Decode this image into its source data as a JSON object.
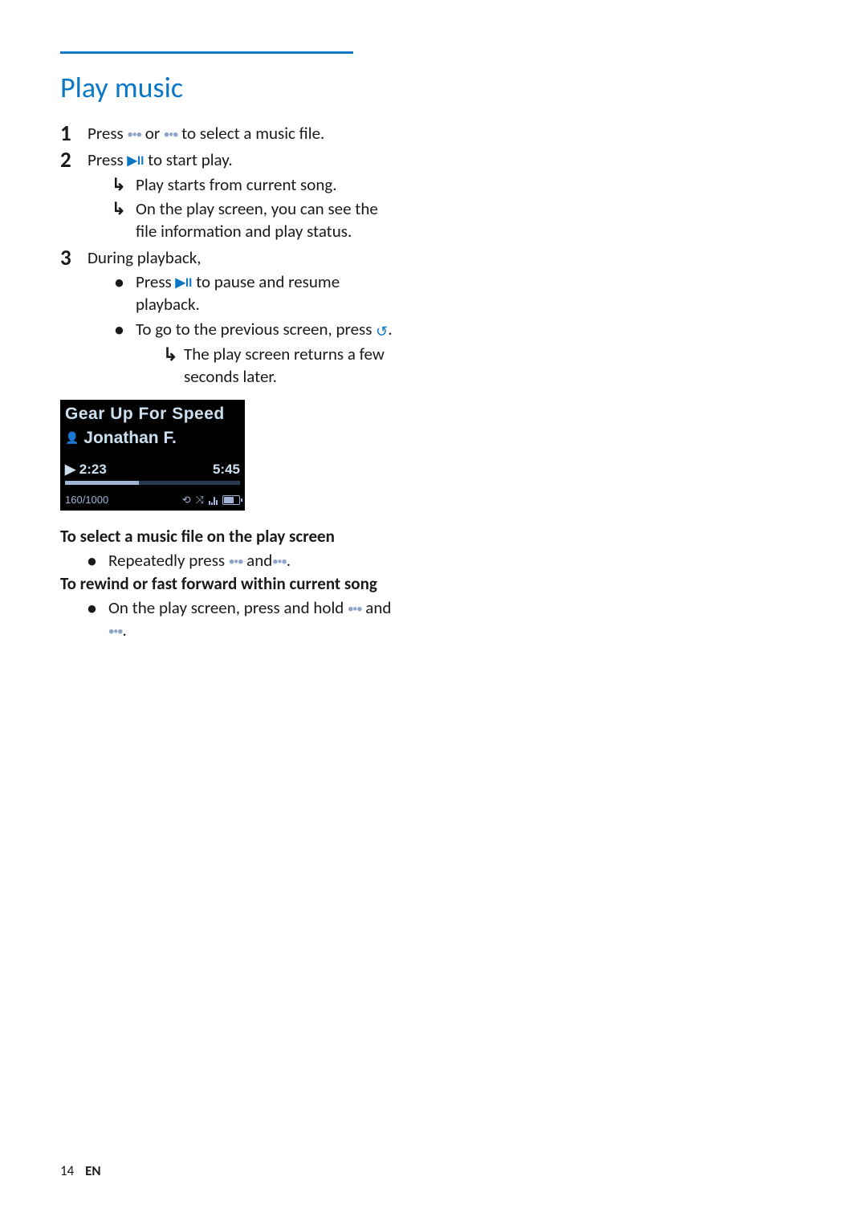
{
  "heading": "Play music",
  "step1": {
    "pre": "Press ",
    "mid": " or ",
    "post": " to select a music file."
  },
  "step2": {
    "pre": "Press ",
    "post": " to start play.",
    "sub1": "Play starts from current song.",
    "sub2": "On the play screen, you can see the file information and play status."
  },
  "step3": {
    "lead": "During playback,",
    "b1pre": "Press ",
    "b1post": " to pause and resume playback.",
    "b2pre": "To go to the previous screen, press ",
    "b2post": ".",
    "b2sub": "The play screen returns a few seconds later."
  },
  "screenshot": {
    "title": "Gear Up For Speed",
    "artist": "Jonathan F.",
    "elapsed": "2:23",
    "total": "5:45",
    "count": "160/1000"
  },
  "select_heading": "To select a music file on the play screen",
  "select_b1pre": "Repeatedly press ",
  "select_b1mid": " and",
  "select_b1post": ".",
  "rewind_heading": "To rewind or fast forward within current song",
  "rewind_b1pre": "On the play screen, press and hold ",
  "rewind_b1mid": " and ",
  "rewind_b1post": ".",
  "footer": {
    "page": "14",
    "lang": "EN"
  }
}
